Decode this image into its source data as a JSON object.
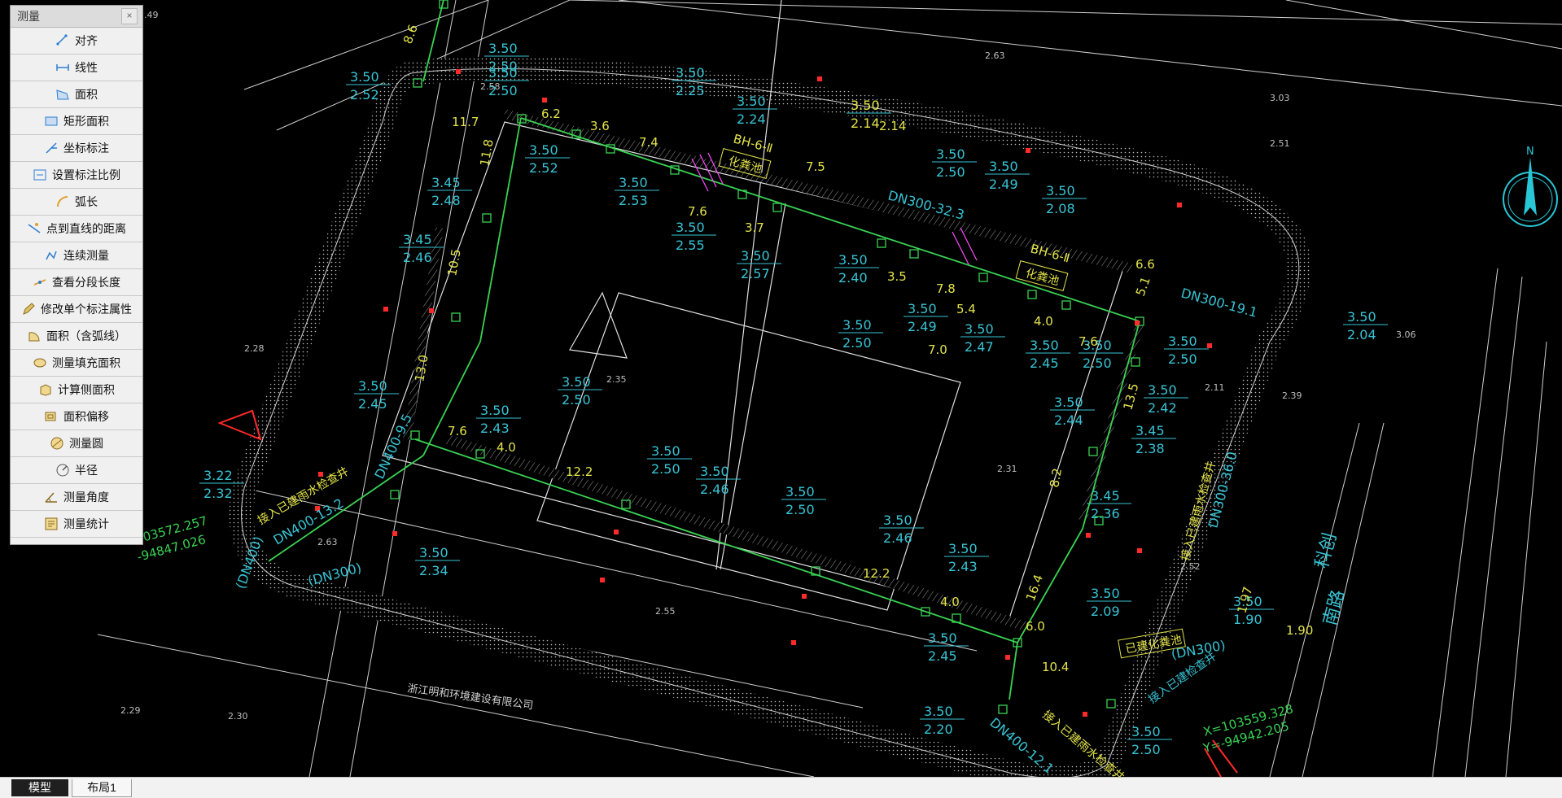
{
  "palette": {
    "title": "测量",
    "close": "×",
    "tools": [
      {
        "label": "对齐",
        "icon": "align-icon"
      },
      {
        "label": "线性",
        "icon": "linear-icon"
      },
      {
        "label": "面积",
        "icon": "area-icon"
      },
      {
        "label": "矩形面积",
        "icon": "rect-area-icon"
      },
      {
        "label": "坐标标注",
        "icon": "coordinate-icon"
      },
      {
        "label": "设置标注比例",
        "icon": "scale-icon"
      },
      {
        "label": "弧长",
        "icon": "arc-length-icon"
      },
      {
        "label": "点到直线的距离",
        "icon": "point-line-icon"
      },
      {
        "label": "连续测量",
        "icon": "continuous-icon"
      },
      {
        "label": "查看分段长度",
        "icon": "segment-icon"
      },
      {
        "label": "修改单个标注属性",
        "icon": "edit-mark-icon"
      },
      {
        "label": "面积（含弧线）",
        "icon": "arc-area-icon"
      },
      {
        "label": "测量填充面积",
        "icon": "hatch-area-icon"
      },
      {
        "label": "计算侧面积",
        "icon": "side-area-icon"
      },
      {
        "label": "面积偏移",
        "icon": "area-offset-icon"
      },
      {
        "label": "测量圆",
        "icon": "circle-icon"
      },
      {
        "label": "半径",
        "icon": "radius-icon"
      },
      {
        "label": "测量角度",
        "icon": "angle-icon"
      },
      {
        "label": "测量统计",
        "icon": "stats-icon"
      }
    ]
  },
  "tabs": [
    "模型",
    "布局1"
  ],
  "drawing": {
    "pipe_labels": [
      "DN300-32.3",
      "DN300-19.1",
      "DN400-13.2",
      "DN400-12.1",
      "DN400-9.5",
      "(DN400)",
      "(DN300)",
      "(DN300)",
      "DN300-36.0"
    ],
    "tank_labels": [
      "化粪池",
      "化粪池",
      "已建化粪池"
    ],
    "manhole_labels": [
      "BH-6-Ⅱ",
      "BH-6-Ⅱ"
    ],
    "connection_labels": [
      "接入已建雨水检查井",
      "接入已建雨水检查井",
      "接入已建检查井",
      "接入已建雨水检查井"
    ],
    "road_labels": [
      "科创",
      "南路"
    ],
    "company_label": "浙江明和环境建设有限公司",
    "coordinates": [
      "X=103559.328",
      "Y=-94942.205",
      "103572.257",
      "-94847.026"
    ],
    "compass_label": "N",
    "elevation_pairs": [
      [
        "3.50",
        "2.52"
      ],
      [
        "3.50",
        "2.50"
      ],
      [
        "3.50",
        "2.50"
      ],
      [
        "3.50",
        "2.25"
      ],
      [
        "3.50",
        "2.24"
      ],
      [
        "3.50",
        "2.14"
      ],
      [
        "3.50",
        "2.50"
      ],
      [
        "3.50",
        "2.49"
      ],
      [
        "3.50",
        "2.08"
      ],
      [
        "3.50",
        "2.52"
      ],
      [
        "3.50",
        "2.53"
      ],
      [
        "3.50",
        "2.55"
      ],
      [
        "3.50",
        "2.57"
      ],
      [
        "3.45",
        "2.48"
      ],
      [
        "3.45",
        "2.46"
      ],
      [
        "3.50",
        "2.40"
      ],
      [
        "3.50",
        "2.50"
      ],
      [
        "3.50",
        "2.49"
      ],
      [
        "3.50",
        "2.47"
      ],
      [
        "3.50",
        "2.45"
      ],
      [
        "3.50",
        "2.50"
      ],
      [
        "3.50",
        "2.04"
      ],
      [
        "3.50",
        "2.50"
      ],
      [
        "3.50",
        "2.42"
      ],
      [
        "3.45",
        "2.38"
      ],
      [
        "3.50",
        "2.44"
      ],
      [
        "3.45",
        "2.36"
      ],
      [
        "3.50",
        "2.45"
      ],
      [
        "3.50",
        "2.46"
      ],
      [
        "3.50",
        "2.50"
      ],
      [
        "3.50",
        "2.43"
      ],
      [
        "3.50",
        "2.50"
      ],
      [
        "3.50",
        "2.46"
      ],
      [
        "3.50",
        "2.43"
      ],
      [
        "3.50",
        "2.09"
      ],
      [
        "3.50",
        "2.45"
      ],
      [
        "3.50",
        "2.20"
      ],
      [
        "3.50",
        "2.50"
      ],
      [
        "3.50",
        "2.34"
      ],
      [
        "3.22",
        "2.32"
      ],
      [
        "3.50",
        "1.90"
      ],
      [
        "3.50",
        "2.50"
      ]
    ],
    "segment_lengths": [
      "8.6",
      "6.2",
      "3.6",
      "7.4",
      "7.6",
      "3.7",
      "7.5",
      "7.8",
      "3.5",
      "6.6",
      "11.7",
      "11.8",
      "10.5",
      "13.0",
      "7.6",
      "4.0",
      "12.2",
      "12.2",
      "4.0",
      "10.4",
      "8.2",
      "7.0",
      "5.4",
      "4.0",
      "7.6",
      "5.1",
      "13.5",
      "16.4",
      "6.0",
      "2.14",
      "1.97",
      "1.90"
    ],
    "ground_levels": [
      "2.49",
      "2.63",
      "2.58",
      "2.28",
      "2.35",
      "3.03",
      "2.51",
      "3.06",
      "2.39",
      "2.31",
      "2.29",
      "2.30",
      "2.11",
      "2.55",
      "2.63",
      "2.52"
    ]
  }
}
